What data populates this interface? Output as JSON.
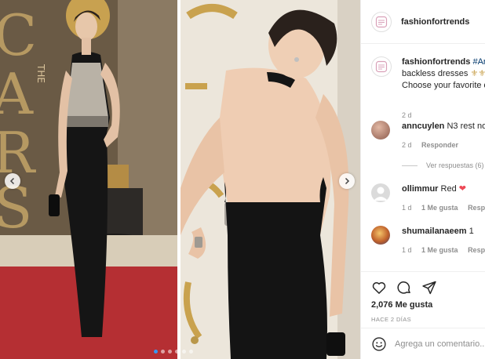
{
  "post": {
    "username": "fashionfortrends",
    "caption_user": "fashionfortrends",
    "caption_tag": "#Ann",
    "caption_line2": "backless dresses",
    "caption_line3": "Choose your favorite d",
    "caption_time": "2 d",
    "likes": "2,076 Me gusta",
    "time_ago": "HACE 2 DÍAS"
  },
  "comments": [
    {
      "username": "anncuylen",
      "text": "N3 rest no",
      "time": "2 d",
      "reply_label": "Responder",
      "like_label": ""
    },
    {
      "username": "ollimmur",
      "text": "Red",
      "time": "1 d",
      "like_label": "1 Me gusta",
      "reply_label": "Respon"
    },
    {
      "username": "shumailanaeem",
      "text": "1",
      "time": "1 d",
      "like_label": "1 Me gusta",
      "reply_label": "Respo"
    }
  ],
  "view_replies_label": "Ver respuestas (6)",
  "add_comment": {
    "placeholder": "Agrega un comentario..."
  },
  "media": {
    "left_background_text": "THE\nOSCARS",
    "carousel_dots": 6,
    "active_dot": 0
  },
  "icons": {
    "like": "heart-icon",
    "comment": "comment-icon",
    "share": "paper-plane-icon",
    "emoji": "emoji-icon",
    "prev": "chevron-left-icon",
    "next": "chevron-right-icon"
  },
  "colors": {
    "accent": "#3897f0",
    "heart_red": "#ed4956",
    "text": "#262626",
    "muted": "#8e8e8e"
  }
}
